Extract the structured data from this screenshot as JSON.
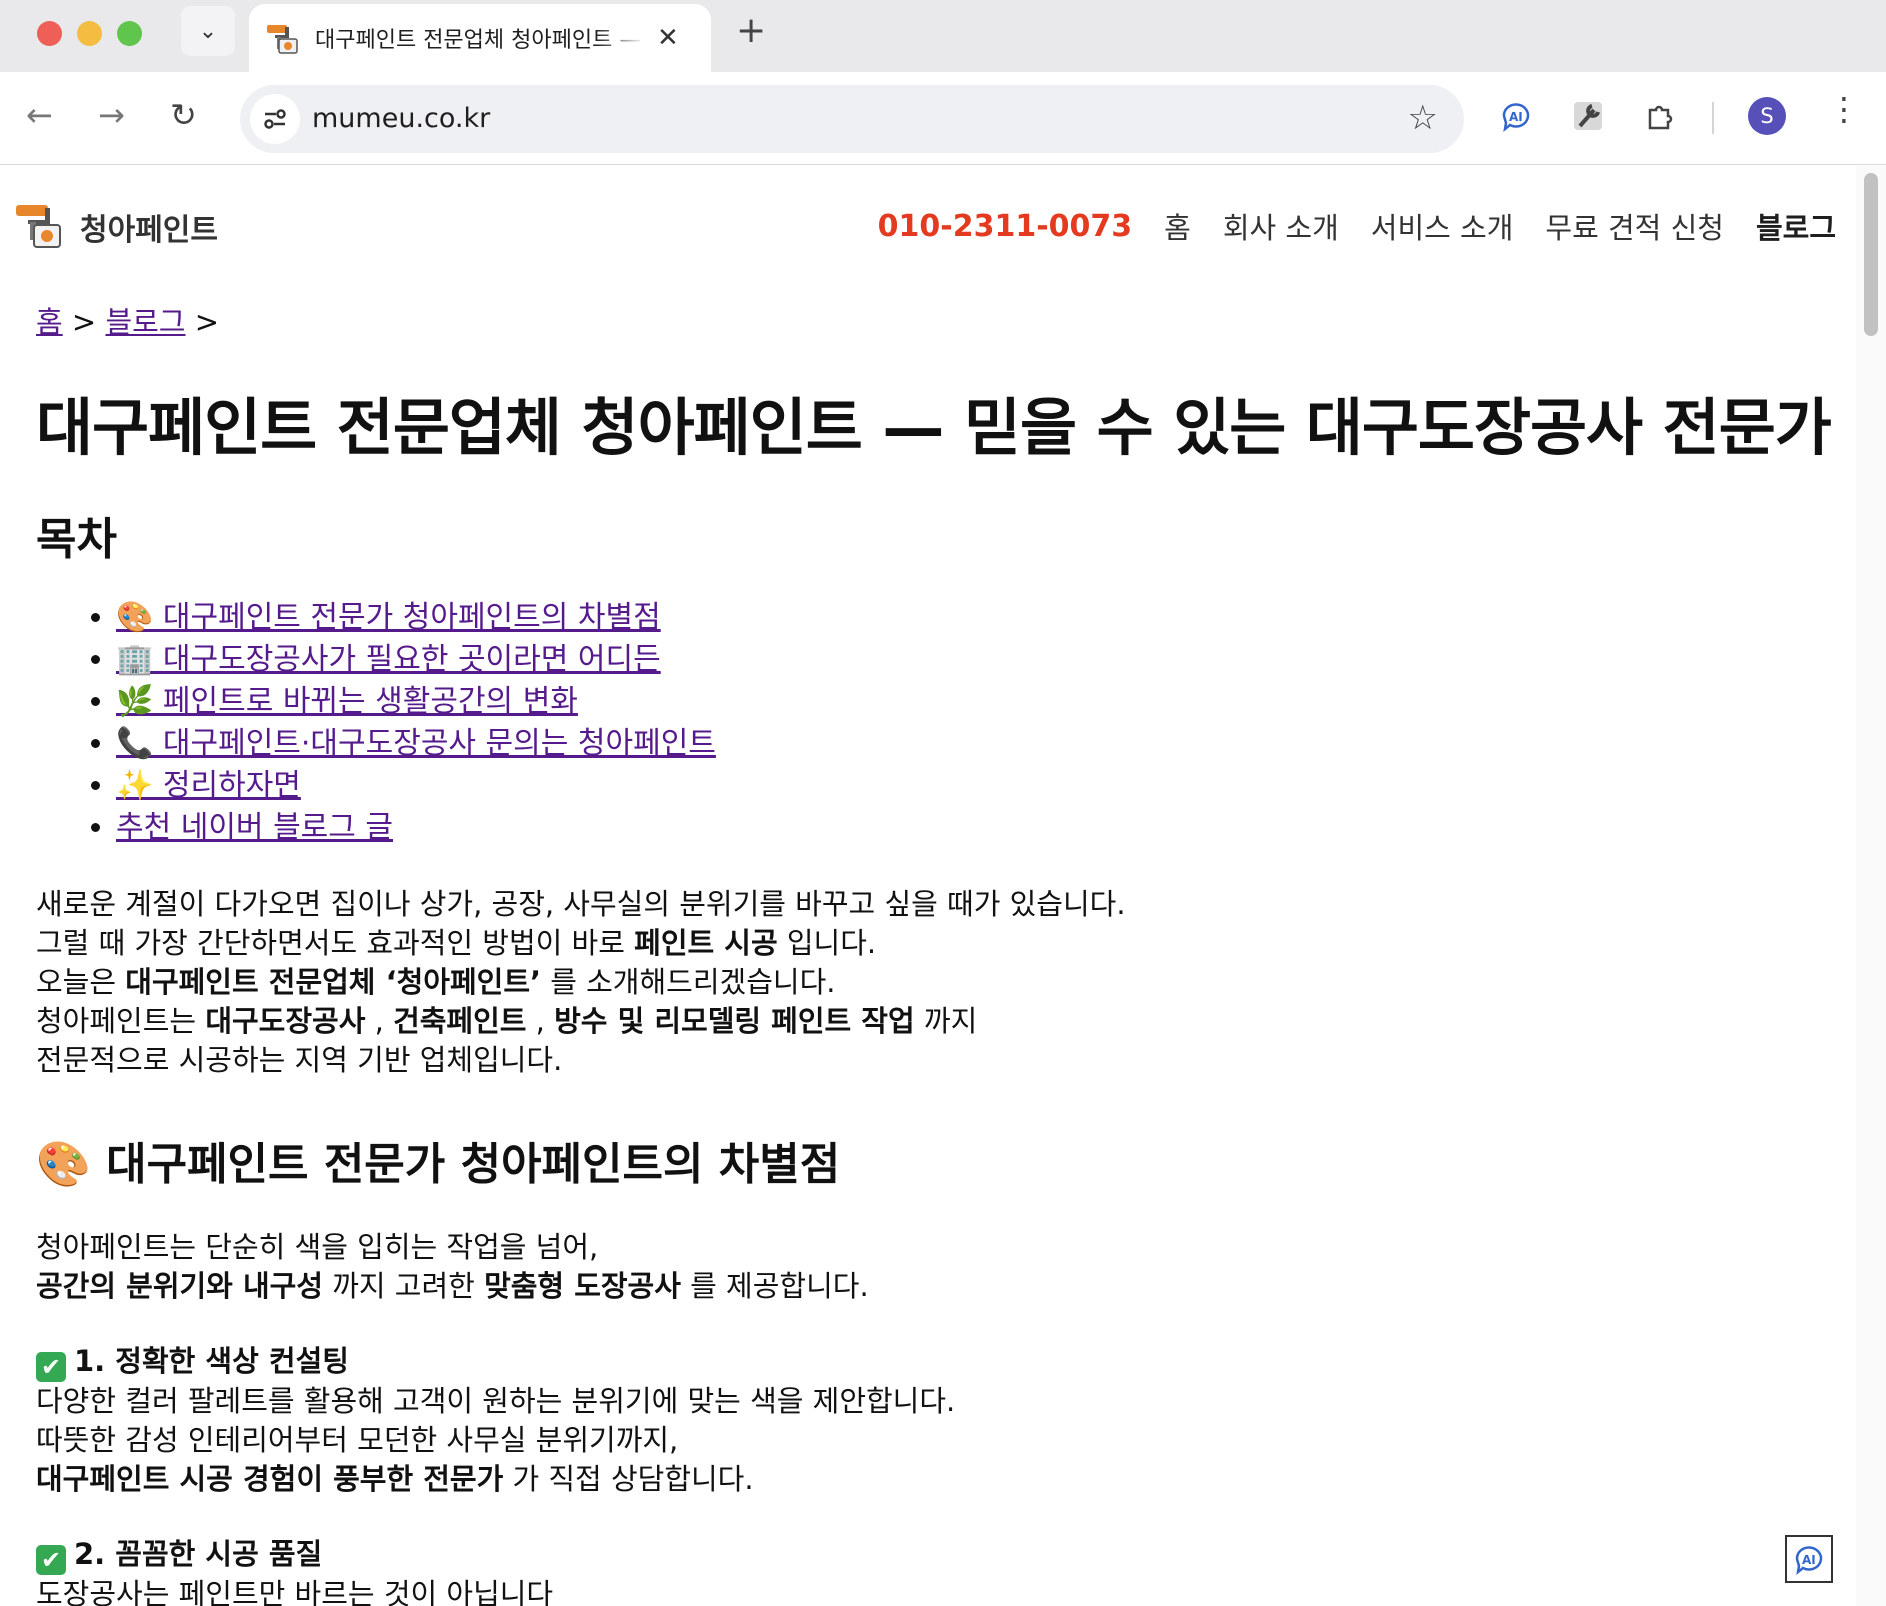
{
  "browser": {
    "tab_title": "대구페인트 전문업체 청아페인트 — 믿을 수 있는 대구도장공사 전문가",
    "url": "mumeu.co.kr",
    "profile_initial": "S"
  },
  "site": {
    "logo_text": "청아페인트",
    "phone": "010-2311-0073",
    "nav": [
      "홈",
      "회사 소개",
      "서비스 소개",
      "무료 견적 신청",
      "블로그"
    ]
  },
  "breadcrumb": {
    "home": "홈",
    "sep": ">",
    "blog": "블로그"
  },
  "article": {
    "title": "대구페인트 전문업체 청아페인트 — 믿을 수 있는 대구도장공사 전문가",
    "toc_title": "목차",
    "toc": [
      "🎨 대구페인트 전문가 청아페인트의 차별점",
      "🏢 대구도장공사가 필요한 곳이라면 어디든",
      "🌿 페인트로 바뀌는 생활공간의 변화",
      "📞 대구페인트·대구도장공사 문의는 청아페인트",
      "✨ 정리하자면",
      "추천 네이버 블로그 글"
    ],
    "intro": {
      "line1": "새로운 계절이 다가오면 집이나 상가, 공장, 사무실의 분위기를 바꾸고 싶을 때가 있습니다.",
      "line2_a": "그럴 때 가장 간단하면서도 효과적인 방법이 바로 ",
      "line2_b": "페인트 시공",
      "line2_c": " 입니다.",
      "line3_a": "오늘은 ",
      "line3_b": "대구페인트 전문업체 ‘청아페인트’",
      "line3_c": " 를 소개해드리겠습니다.",
      "line4_a": "청아페인트는 ",
      "line4_b": "대구도장공사",
      "line4_c": " , ",
      "line4_d": "건축페인트",
      "line4_e": " , ",
      "line4_f": "방수 및 리모델링 페인트 작업",
      "line4_g": " 까지",
      "line5": "전문적으로 시공하는 지역 기반 업체입니다."
    },
    "section1": {
      "heading": "🎨 대구페인트 전문가 청아페인트의 차별점",
      "p1_line1": "청아페인트는 단순히 색을 입히는 작업을 넘어,",
      "p1_b1": "공간의 분위기와 내구성",
      "p1_t1": " 까지 고려한 ",
      "p1_b2": "맞춤형 도장공사",
      "p1_t2": " 를 제공합니다.",
      "feature1_title": "1. 정확한 색상 컨설팅",
      "feature1_line1": "다양한 컬러 팔레트를 활용해 고객이 원하는 분위기에 맞는 색을 제안합니다.",
      "feature1_line2": "따뜻한 감성 인테리어부터 모던한 사무실 분위기까지,",
      "feature1_b": "대구페인트 시공 경험이 풍부한 전문가",
      "feature1_t": " 가 직접 상담합니다.",
      "feature2_title": "2. 꼼꼼한 시공 품질",
      "feature2_line1": "도장공사는 페인트만 바르는 것이 아닙니다"
    }
  },
  "colors": {
    "phone": "#e43a1f",
    "link": "#551a8b",
    "check": "#35a853"
  },
  "icons": [
    "site-info-icon",
    "star-icon",
    "ai-extension-icon",
    "tool-extension-icon",
    "puzzle-icon",
    "menu-icon"
  ]
}
